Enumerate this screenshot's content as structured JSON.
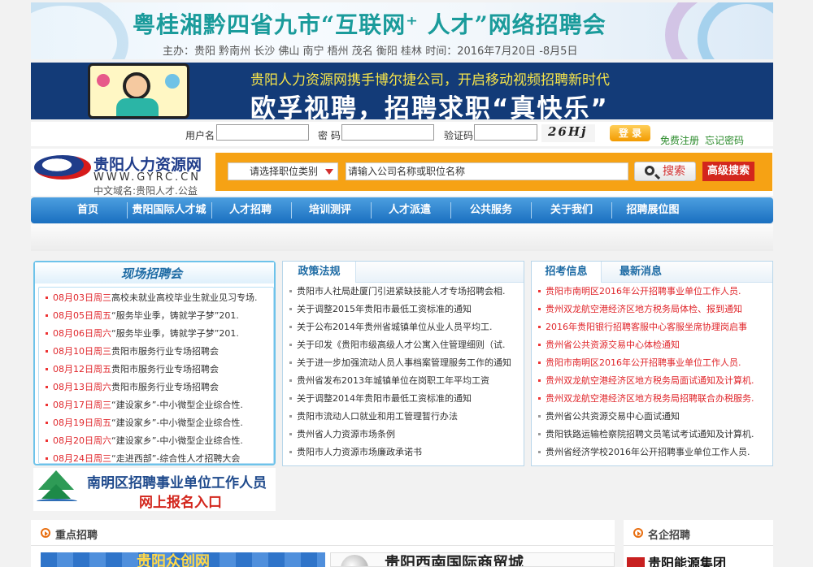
{
  "banner1": {
    "title": "粤桂湘黔四省九市“互联网⁺ 人才”网络招聘会",
    "subtitle": "主办：贵阳  黔南州  长沙  佛山  南宁  梧州  茂名  衡阳  桂林      时间：2016年7月20日 -8月5日"
  },
  "banner2": {
    "line1": "贵阳人力资源网携手博尔捷公司，开启移动视频招聘新时代",
    "line2": "欧孚视聘，招聘求职“真快乐”"
  },
  "login": {
    "username_label": "用户名",
    "password_label": "密 码",
    "captcha_label": "验证码",
    "captcha_text": "26Hj",
    "login_button": "登 录",
    "register_link": "免费注册",
    "forgot_link": "忘记密码"
  },
  "logo": {
    "name": "贵阳人力资源网",
    "domain_en": "WWW.GYRC.CN",
    "domain_cn": "中文域名:贵阳人才.公益"
  },
  "search": {
    "category_select": "请选择职位类别",
    "keyword_value": "请输入公司名称或职位名称",
    "search_button": "搜索",
    "advanced_button": "高级搜索"
  },
  "nav": {
    "items": [
      "首页",
      "贵阳国际人才城",
      "人才招聘",
      "培训测评",
      "人才派遣",
      "公共服务",
      "关于我们",
      "招聘展位图"
    ]
  },
  "fairs": {
    "title": "现场招聘会",
    "items": [
      {
        "date": "08月03日周三",
        "text": "高校未就业高校毕业生就业见习专场."
      },
      {
        "date": "08月05日周五",
        "text": "“服务毕业季，铸就学子梦”201."
      },
      {
        "date": "08月06日周六",
        "text": "“服务毕业季，铸就学子梦”201."
      },
      {
        "date": "08月10日周三",
        "text": "贵阳市服务行业专场招聘会"
      },
      {
        "date": "08月12日周五",
        "text": "贵阳市服务行业专场招聘会"
      },
      {
        "date": "08月13日周六",
        "text": "贵阳市服务行业专场招聘会"
      },
      {
        "date": "08月17日周三",
        "text": "“建设家乡”-中小微型企业综合性."
      },
      {
        "date": "08月19日周五",
        "text": "“建设家乡”-中小微型企业综合性."
      },
      {
        "date": "08月20日周六",
        "text": "“建设家乡”-中小微型企业综合性."
      },
      {
        "date": "08月24日周三",
        "text": "“走进西部”-综合性人才招聘大会"
      }
    ]
  },
  "policy": {
    "title": "政策法规",
    "items": [
      "贵阳市人社局赴厦门引进紧缺技能人才专场招聘会相.",
      "关于调整2015年贵阳市最低工资标准的通知",
      "关于公布2014年贵州省城镇单位从业人员平均工.",
      "关于印发《贵阳市级高级人才公寓入住管理细则（试.",
      "关于进一步加强流动人员人事档案管理服务工作的通知",
      "贵州省发布2013年城镇单位在岗职工年平均工资",
      "关于调整2014年贵阳市最低工资标准的通知",
      "贵阳市流动人口就业和用工管理暂行办法",
      "贵州省人力资源市场条例",
      "贵阳市人力资源市场廉政承诺书"
    ]
  },
  "exam": {
    "tab1": "招考信息",
    "tab2": "最新消息",
    "items": [
      {
        "text": "贵阳市南明区2016年公开招聘事业单位工作人员.",
        "red": true
      },
      {
        "text": "贵州双龙航空港经济区地方税务局体检、报到通知",
        "red": true
      },
      {
        "text": "2016年贵阳银行招聘客服中心客服坐席协理岗启事",
        "red": true
      },
      {
        "text": "贵州省公共资源交易中心体检通知",
        "red": true
      },
      {
        "text": "贵阳市南明区2016年公开招聘事业单位工作人员.",
        "red": true
      },
      {
        "text": "贵州双龙航空港经济区地方税务局面试通知及计算机.",
        "red": true
      },
      {
        "text": "贵州双龙航空港经济区地方税务局招聘联合办税服务.",
        "red": true
      },
      {
        "text": "贵州省公共资源交易中心面试通知",
        "red": false
      },
      {
        "text": "贵阳铁路运输检察院招聘文员笔试考试通知及计算机.",
        "red": false
      },
      {
        "text": "贵州省经济学校2016年公开招聘事业单位工作人员.",
        "red": false
      }
    ]
  },
  "ad_nanming": {
    "line1": "南明区招聘事业单位工作人员",
    "line2": "网上报名入口"
  },
  "key_recruit": {
    "title": "重点招聘",
    "ad1": "贵阳众创网",
    "ad2": "贵阳西南国际商贸城"
  },
  "famous": {
    "title": "名企招聘",
    "ad1": "贵阳能源集团"
  },
  "colors": {
    "nav_blue": "#1a6fc0",
    "search_orange": "#f6a214",
    "accent_red": "#e0262b"
  }
}
